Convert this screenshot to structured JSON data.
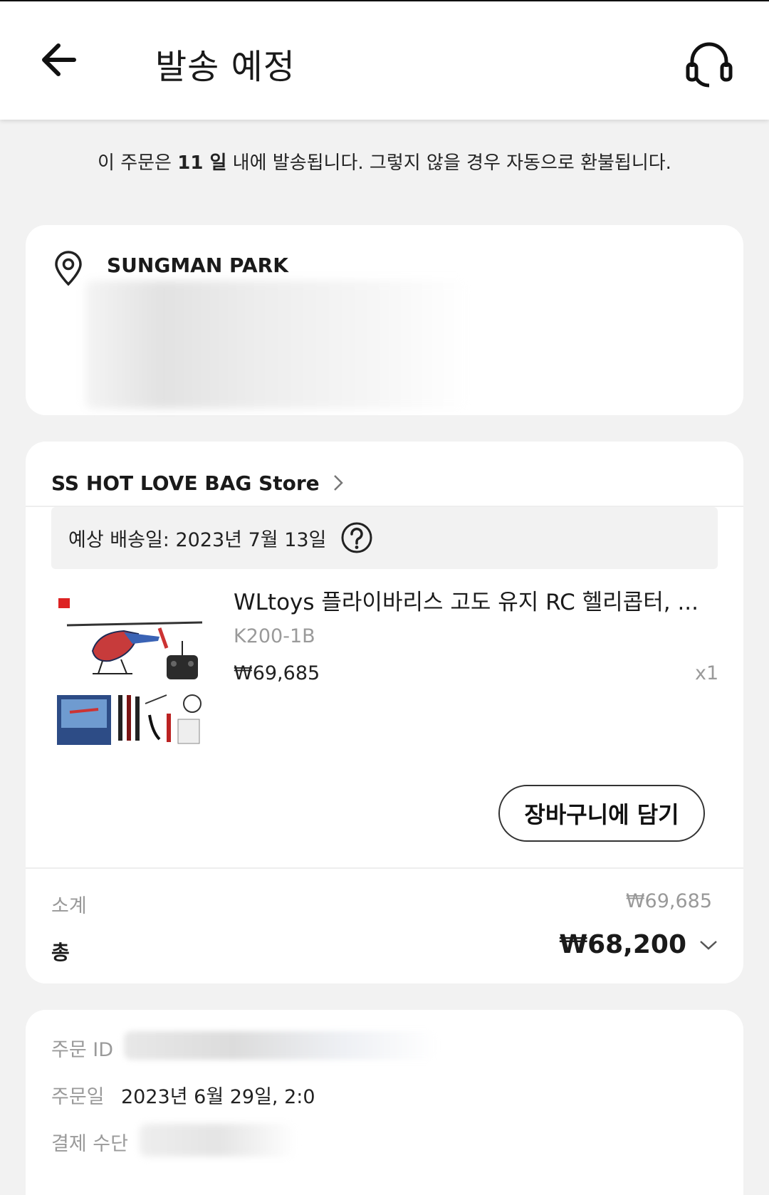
{
  "header": {
    "title": "발송 예정",
    "back_icon": "arrow-left-icon",
    "support_icon": "headset-icon"
  },
  "notice": {
    "prefix": "이 주문은 ",
    "days": "11 일",
    "suffix": " 내에 발송됩니다. 그렇지 않을 경우 자동으로 환불됩니다."
  },
  "address": {
    "name": "SUNGMAN PARK",
    "icon": "location-pin-icon"
  },
  "store": {
    "name": "SS HOT LOVE BAG Store",
    "estimated_delivery": "예상 배송일: 2023년 7월 13일",
    "product": {
      "title": "WLtoys 플라이바리스 고도 유지 RC 헬리콥터, ...",
      "variant": "K200-1B",
      "price": "₩69,685",
      "quantity": "x1"
    },
    "add_to_cart_label": "장바구니에 담기",
    "subtotal_label": "소계",
    "subtotal_value": "₩69,685",
    "total_label": "총",
    "total_value": "₩68,200"
  },
  "order_info": {
    "order_id_label": "주문 ID",
    "order_date_label": "주문일",
    "order_date_value": "2023년 6월 29일, 2:0",
    "payment_label": "결제 수단"
  },
  "colors": {
    "background": "#f2f2f2",
    "card": "#ffffff",
    "muted_text": "#9a9a9a"
  }
}
